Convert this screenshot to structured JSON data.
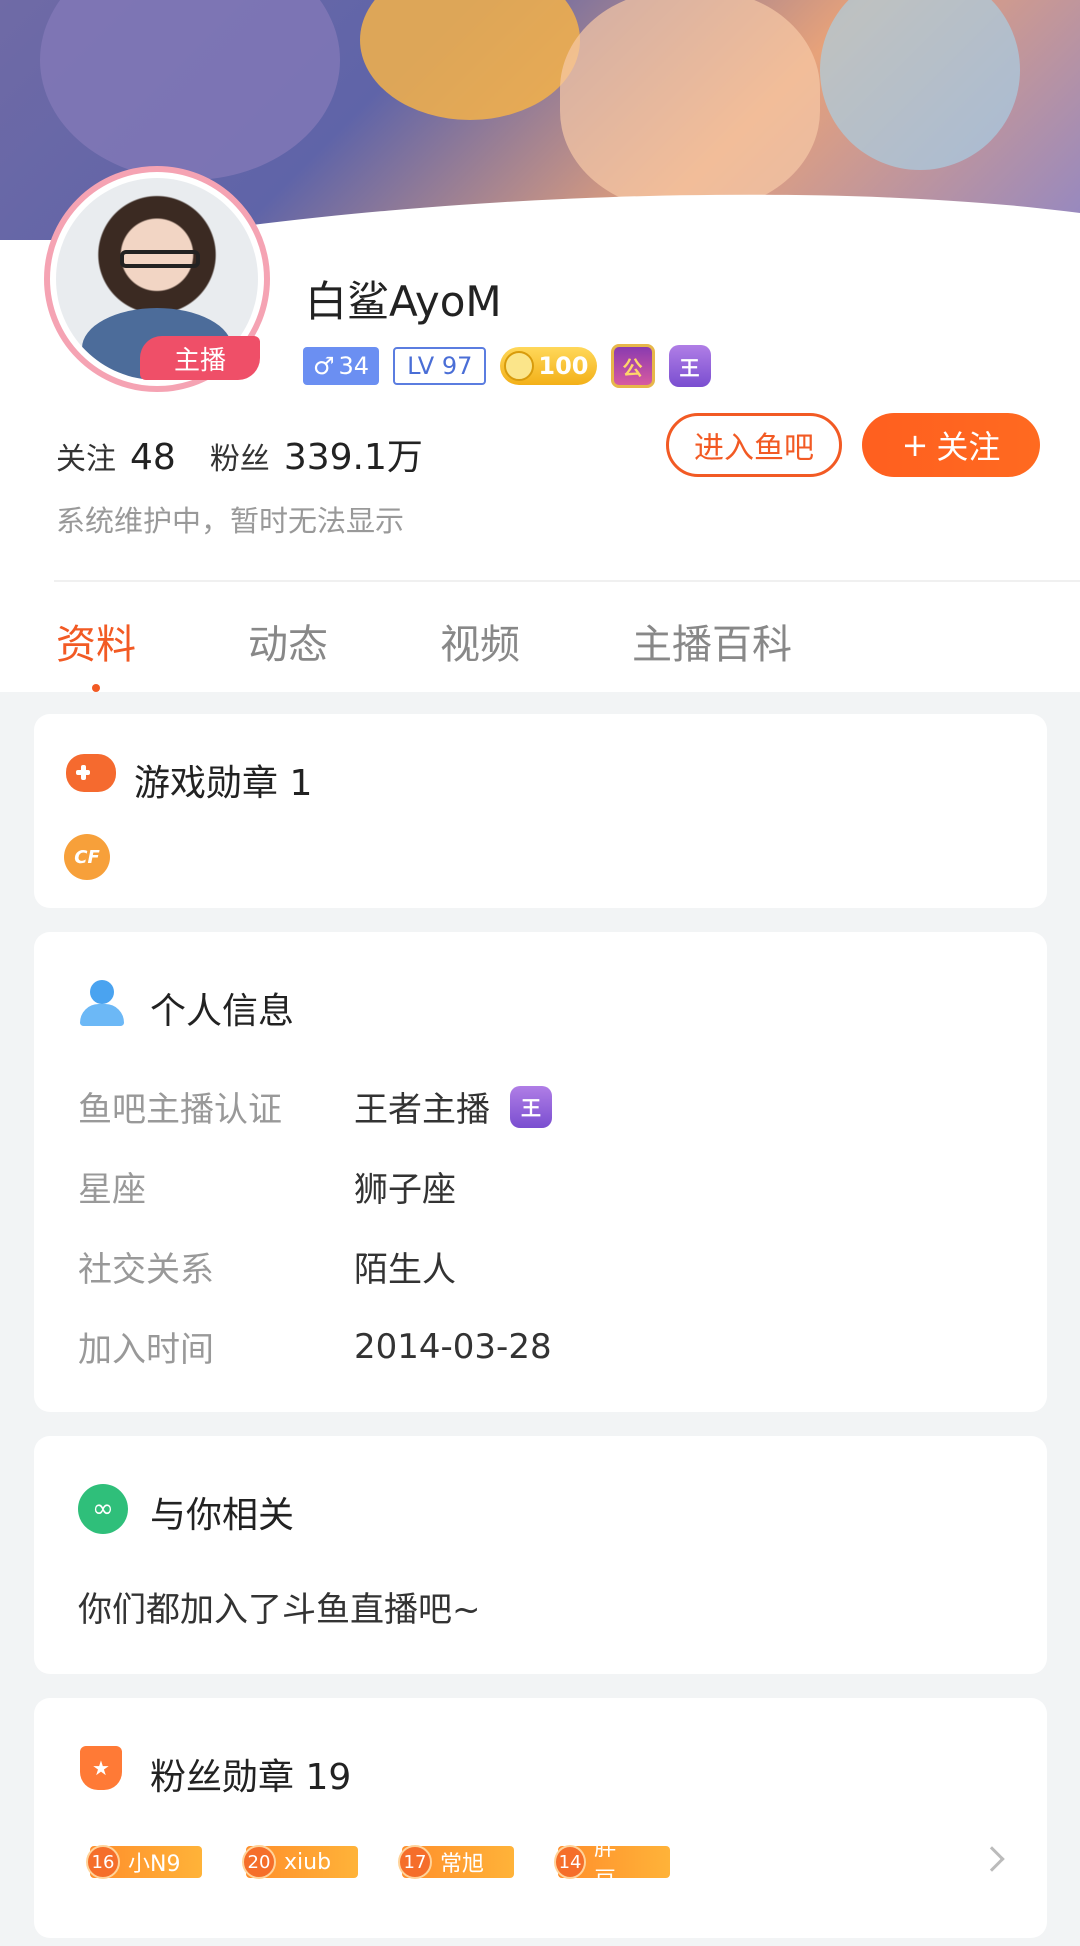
{
  "profile": {
    "username": "白鲨AyoM",
    "host_tag": "主播",
    "gender_symbol": "♂",
    "gender_level": "34",
    "lv_label": "LV 97",
    "gold_badge": "100",
    "shield_badge": "公",
    "king_badge": "王",
    "stats": {
      "follow_label": "关注",
      "follow_count": "48",
      "fans_label": "粉丝",
      "fans_count": "339.1万"
    },
    "subtitle": "系统维护中，暂时无法显示",
    "btn_enter_bar": "进入鱼吧",
    "btn_follow_plus": "+",
    "btn_follow": "关注"
  },
  "tabs": [
    {
      "label": "资料"
    },
    {
      "label": "动态"
    },
    {
      "label": "视频"
    },
    {
      "label": "主播百科"
    }
  ],
  "game_medals": {
    "title": "游戏勋章 1",
    "medal_text": "CF"
  },
  "personal_info": {
    "title": "个人信息",
    "rows": [
      {
        "key": "鱼吧主播认证",
        "value": "王者主播",
        "badge": "王"
      },
      {
        "key": "星座",
        "value": "狮子座"
      },
      {
        "key": "社交关系",
        "value": "陌生人"
      },
      {
        "key": "加入时间",
        "value": "2014-03-28"
      }
    ]
  },
  "related": {
    "title": "与你相关",
    "text": "你们都加入了斗鱼直播吧~"
  },
  "fan_medals": {
    "title": "粉丝勋章 19",
    "items": [
      {
        "level": "16",
        "name": "小N9"
      },
      {
        "level": "20",
        "name": "xiub"
      },
      {
        "level": "17",
        "name": "常旭"
      },
      {
        "level": "14",
        "name": "胖豆、"
      }
    ]
  }
}
